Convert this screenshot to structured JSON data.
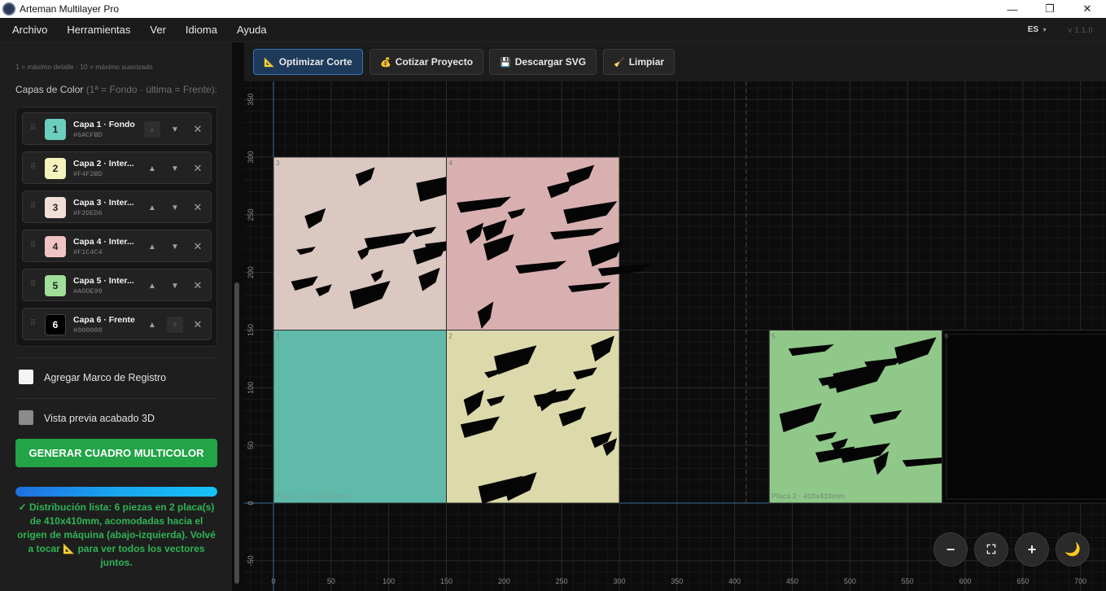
{
  "window": {
    "title": "Arteman Multilayer Pro",
    "minimize": "—",
    "maximize": "❐",
    "close": "✕"
  },
  "menu": {
    "items": [
      "Archivo",
      "Herramientas",
      "Ver",
      "Idioma",
      "Ayuda"
    ],
    "language": "ES",
    "version": "v 1.1.0"
  },
  "sidebar": {
    "smooth_hint": "1 = máximo detalle · 10 = máximo suavizado",
    "layers_title": "Capas de Color",
    "layers_title_muted": "(1ª = Fondo · última = Frente):",
    "layers": [
      {
        "number": "1",
        "name": "Capa 1 · Fondo",
        "hex": "#6ACFBD",
        "color": "#6acfbd",
        "up_disabled": true,
        "down_disabled": false
      },
      {
        "number": "2",
        "name": "Capa 2 · Inter...",
        "hex": "#F4F2BD",
        "color": "#f4f2bd",
        "up_disabled": false,
        "down_disabled": false
      },
      {
        "number": "3",
        "name": "Capa 3 · Inter...",
        "hex": "#F2DED6",
        "color": "#f2ded6",
        "up_disabled": false,
        "down_disabled": false
      },
      {
        "number": "4",
        "name": "Capa 4 · Inter...",
        "hex": "#F1C4C4",
        "color": "#f1c4c4",
        "up_disabled": false,
        "down_disabled": false
      },
      {
        "number": "5",
        "name": "Capa 5 · Inter...",
        "hex": "#A0DE99",
        "color": "#a0de99",
        "up_disabled": false,
        "down_disabled": false
      },
      {
        "number": "6",
        "name": "Capa 6 · Frente",
        "hex": "#000000",
        "color": "#000000",
        "up_disabled": false,
        "down_disabled": true
      }
    ],
    "registro_label": "Agregar Marco de Registro",
    "preview3d_label": "Vista previa acabado 3D",
    "generate_label": "GENERAR CUADRO MULTICOLOR",
    "progress": 1.0,
    "status_text": "✓ Distribución lista: 6 piezas en 2 placa(s) de 410x410mm, acomodadas hacia el origen de máquina (abajo-izquierda). Volvé a tocar 📐 para ver todos los vectores juntos."
  },
  "toolbar": {
    "optimize": "Optimizar Corte",
    "optimize_icon": "📐",
    "quote": "Cotizar Proyecto",
    "quote_icon": "💰",
    "download": "Descargar SVG",
    "download_icon": "💾",
    "clear": "Limpiar",
    "clear_icon": "🧹"
  },
  "canvas": {
    "x_ticks": [
      "0",
      "50",
      "100",
      "150",
      "200",
      "250",
      "300",
      "350",
      "400",
      "450",
      "500",
      "550",
      "600",
      "650",
      "700"
    ],
    "y_ticks": [
      "350",
      "300",
      "250",
      "200",
      "150",
      "100",
      "50",
      "0",
      "-50"
    ],
    "plate1_label": "Placa 1 · 410x410mm",
    "plate2_label": "Placa 2 · 410x410mm",
    "pieces": [
      {
        "id": "1",
        "color": "#5fbaa9"
      },
      {
        "id": "2",
        "color": "#dcdaab"
      },
      {
        "id": "3",
        "color": "#dac8c1"
      },
      {
        "id": "4",
        "color": "#d9b0b0"
      },
      {
        "id": "5",
        "color": "#90c88a"
      },
      {
        "id": "6",
        "color": "#050505"
      }
    ]
  },
  "zoom": {
    "out": "−",
    "fit": "⛶",
    "in": "+",
    "theme": "🌙"
  }
}
